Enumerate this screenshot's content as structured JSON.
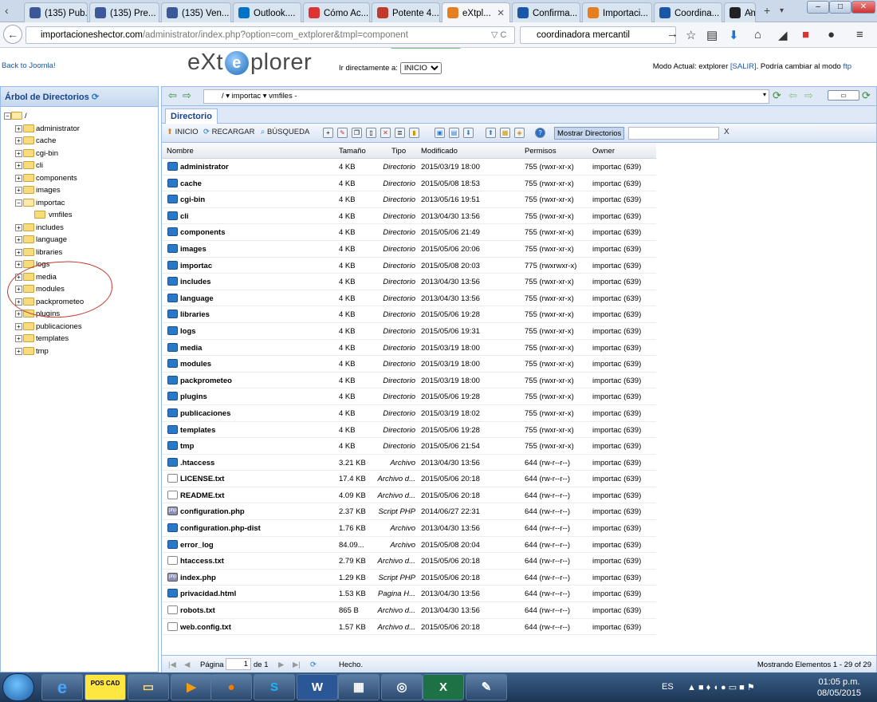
{
  "browser": {
    "tabs": [
      {
        "label": "(135) Pub...",
        "fav": "facebook-icon",
        "color": "#3b5998"
      },
      {
        "label": "(135) Pre...",
        "fav": "facebook-icon",
        "color": "#3b5998"
      },
      {
        "label": "(135) Ven...",
        "fav": "facebook-icon",
        "color": "#3b5998"
      },
      {
        "label": "Outlook....",
        "fav": "outlook-icon",
        "color": "#0072c6"
      },
      {
        "label": "Cómo Ac...",
        "fav": "wix-icon",
        "color": "#d33"
      },
      {
        "label": "Potente 4...",
        "fav": "tab-icon",
        "color": "#c0392b"
      },
      {
        "label": "eXtpl...",
        "fav": "extplorer-icon",
        "color": "#e67e22"
      },
      {
        "label": "Confirma...",
        "fav": "h-icon",
        "color": "#1a56a8"
      },
      {
        "label": "Importaci...",
        "fav": "extplorer-icon",
        "color": "#e67e22"
      },
      {
        "label": "Coordina...",
        "fav": "link-icon",
        "color": "#1a56a8"
      },
      {
        "label": "Am",
        "fav": "amazon-icon",
        "color": "#222"
      }
    ],
    "url_host": "importacioneshector.com",
    "url_path": "/administrator/index.php?option=com_extplorer&tmpl=component",
    "search_value": "coordinadora mercantil"
  },
  "header": {
    "back_link": "Back to Joomla!",
    "logo_left": "eXt",
    "logo_mid": "e",
    "logo_right": "plorer",
    "goto_label": "Ir directamente a:",
    "goto_value": "INICIO",
    "mode_text": "Modo Actual: extplorer",
    "mode_exit": "[SALIR]",
    "mode_change": ". Podría cambiar al modo",
    "mode_ftp": "ftp"
  },
  "tree": {
    "title": "Árbol de Directorios",
    "root": "/",
    "items": [
      "administrator",
      "cache",
      "cgi-bin",
      "cli",
      "components",
      "images",
      "importac",
      "vmfiles",
      "includes",
      "language",
      "libraries",
      "logs",
      "media",
      "modules",
      "packprometeo",
      "plugins",
      "publicaciones",
      "templates",
      "tmp"
    ]
  },
  "pathbar": {
    "path": "/  ▾  importac  ▾  vmfiles  -"
  },
  "panel": {
    "tab": "Directorio"
  },
  "toolbar": {
    "home": "INICIO",
    "reload": "RECARGAR",
    "search": "BÚSQUEDA",
    "show_dirs": "Mostrar Directorios",
    "clear": "X"
  },
  "grid": {
    "headers": {
      "name": "Nombre",
      "size": "Tamaño",
      "type": "Tipo",
      "modified": "Modificado",
      "perms": "Permisos",
      "owner": "Owner"
    },
    "rows": [
      {
        "name": "administrator",
        "size": "4 KB",
        "type": "Directorio",
        "mod": "2015/03/19 18:00",
        "perm": "755 (rwxr-xr-x)",
        "owner": "importac (639)",
        "icon": "dir"
      },
      {
        "name": "cache",
        "size": "4 KB",
        "type": "Directorio",
        "mod": "2015/05/08 18:53",
        "perm": "755 (rwxr-xr-x)",
        "owner": "importac (639)",
        "icon": "dir"
      },
      {
        "name": "cgi-bin",
        "size": "4 KB",
        "type": "Directorio",
        "mod": "2013/05/16 19:51",
        "perm": "755 (rwxr-xr-x)",
        "owner": "importac (639)",
        "icon": "dir"
      },
      {
        "name": "cli",
        "size": "4 KB",
        "type": "Directorio",
        "mod": "2013/04/30 13:56",
        "perm": "755 (rwxr-xr-x)",
        "owner": "importac (639)",
        "icon": "dir"
      },
      {
        "name": "components",
        "size": "4 KB",
        "type": "Directorio",
        "mod": "2015/05/06 21:49",
        "perm": "755 (rwxr-xr-x)",
        "owner": "importac (639)",
        "icon": "dir"
      },
      {
        "name": "images",
        "size": "4 KB",
        "type": "Directorio",
        "mod": "2015/05/06 20:06",
        "perm": "755 (rwxr-xr-x)",
        "owner": "importac (639)",
        "icon": "dir"
      },
      {
        "name": "importac",
        "size": "4 KB",
        "type": "Directorio",
        "mod": "2015/05/08 20:03",
        "perm": "775 (rwxrwxr-x)",
        "owner": "importac (639)",
        "icon": "dir"
      },
      {
        "name": "includes",
        "size": "4 KB",
        "type": "Directorio",
        "mod": "2013/04/30 13:56",
        "perm": "755 (rwxr-xr-x)",
        "owner": "importac (639)",
        "icon": "dir"
      },
      {
        "name": "language",
        "size": "4 KB",
        "type": "Directorio",
        "mod": "2013/04/30 13:56",
        "perm": "755 (rwxr-xr-x)",
        "owner": "importac (639)",
        "icon": "dir"
      },
      {
        "name": "libraries",
        "size": "4 KB",
        "type": "Directorio",
        "mod": "2015/05/06 19:28",
        "perm": "755 (rwxr-xr-x)",
        "owner": "importac (639)",
        "icon": "dir"
      },
      {
        "name": "logs",
        "size": "4 KB",
        "type": "Directorio",
        "mod": "2015/05/06 19:31",
        "perm": "755 (rwxr-xr-x)",
        "owner": "importac (639)",
        "icon": "dir"
      },
      {
        "name": "media",
        "size": "4 KB",
        "type": "Directorio",
        "mod": "2015/03/19 18:00",
        "perm": "755 (rwxr-xr-x)",
        "owner": "importac (639)",
        "icon": "dir"
      },
      {
        "name": "modules",
        "size": "4 KB",
        "type": "Directorio",
        "mod": "2015/03/19 18:00",
        "perm": "755 (rwxr-xr-x)",
        "owner": "importac (639)",
        "icon": "dir"
      },
      {
        "name": "packprometeo",
        "size": "4 KB",
        "type": "Directorio",
        "mod": "2015/03/19 18:00",
        "perm": "755 (rwxr-xr-x)",
        "owner": "importac (639)",
        "icon": "dir"
      },
      {
        "name": "plugins",
        "size": "4 KB",
        "type": "Directorio",
        "mod": "2015/05/06 19:28",
        "perm": "755 (rwxr-xr-x)",
        "owner": "importac (639)",
        "icon": "dir"
      },
      {
        "name": "publicaciones",
        "size": "4 KB",
        "type": "Directorio",
        "mod": "2015/03/19 18:02",
        "perm": "755 (rwxr-xr-x)",
        "owner": "importac (639)",
        "icon": "dir"
      },
      {
        "name": "templates",
        "size": "4 KB",
        "type": "Directorio",
        "mod": "2015/05/06 19:28",
        "perm": "755 (rwxr-xr-x)",
        "owner": "importac (639)",
        "icon": "dir"
      },
      {
        "name": "tmp",
        "size": "4 KB",
        "type": "Directorio",
        "mod": "2015/05/06 21:54",
        "perm": "755 (rwxr-xr-x)",
        "owner": "importac (639)",
        "icon": "dir"
      },
      {
        "name": ".htaccess",
        "size": "3.21 KB",
        "type": "Archivo",
        "mod": "2013/04/30 13:56",
        "perm": "644 (rw-r--r--)",
        "owner": "importac (639)",
        "icon": "txt"
      },
      {
        "name": "LICENSE.txt",
        "size": "17.4 KB",
        "type": "Archivo d...",
        "mod": "2015/05/06 20:18",
        "perm": "644 (rw-r--r--)",
        "owner": "importac (639)",
        "icon": "file"
      },
      {
        "name": "README.txt",
        "size": "4.09 KB",
        "type": "Archivo d...",
        "mod": "2015/05/06 20:18",
        "perm": "644 (rw-r--r--)",
        "owner": "importac (639)",
        "icon": "file"
      },
      {
        "name": "configuration.php",
        "size": "2.37 KB",
        "type": "Script PHP",
        "mod": "2014/06/27 22:31",
        "perm": "644 (rw-r--r--)",
        "owner": "importac (639)",
        "icon": "php"
      },
      {
        "name": "configuration.php-dist",
        "size": "1.76 KB",
        "type": "Archivo",
        "mod": "2013/04/30 13:56",
        "perm": "644 (rw-r--r--)",
        "owner": "importac (639)",
        "icon": "txt"
      },
      {
        "name": "error_log",
        "size": "84.09...",
        "type": "Archivo",
        "mod": "2015/05/08 20:04",
        "perm": "644 (rw-r--r--)",
        "owner": "importac (639)",
        "icon": "txt"
      },
      {
        "name": "htaccess.txt",
        "size": "2.79 KB",
        "type": "Archivo d...",
        "mod": "2015/05/06 20:18",
        "perm": "644 (rw-r--r--)",
        "owner": "importac (639)",
        "icon": "file"
      },
      {
        "name": "index.php",
        "size": "1.29 KB",
        "type": "Script PHP",
        "mod": "2015/05/06 20:18",
        "perm": "644 (rw-r--r--)",
        "owner": "importac (639)",
        "icon": "php"
      },
      {
        "name": "privacidad.html",
        "size": "1.53 KB",
        "type": "Pagina H...",
        "mod": "2013/04/30 13:56",
        "perm": "644 (rw-r--r--)",
        "owner": "importac (639)",
        "icon": "txt"
      },
      {
        "name": "robots.txt",
        "size": "865 B",
        "type": "Archivo d...",
        "mod": "2013/04/30 13:56",
        "perm": "644 (rw-r--r--)",
        "owner": "importac (639)",
        "icon": "file"
      },
      {
        "name": "web.config.txt",
        "size": "1.57 KB",
        "type": "Archivo d...",
        "mod": "2015/05/06 20:18",
        "perm": "644 (rw-r--r--)",
        "owner": "importac (639)",
        "icon": "file"
      }
    ]
  },
  "paging": {
    "page_label": "Página",
    "page": "1",
    "of": "de 1",
    "status": "Hecho.",
    "showing": "Mostrando Elementos 1 - 29 of 29"
  },
  "taskbar": {
    "lang": "ES",
    "time": "01:05 p.m.",
    "date": "08/05/2015",
    "pos": "POS CAD"
  }
}
